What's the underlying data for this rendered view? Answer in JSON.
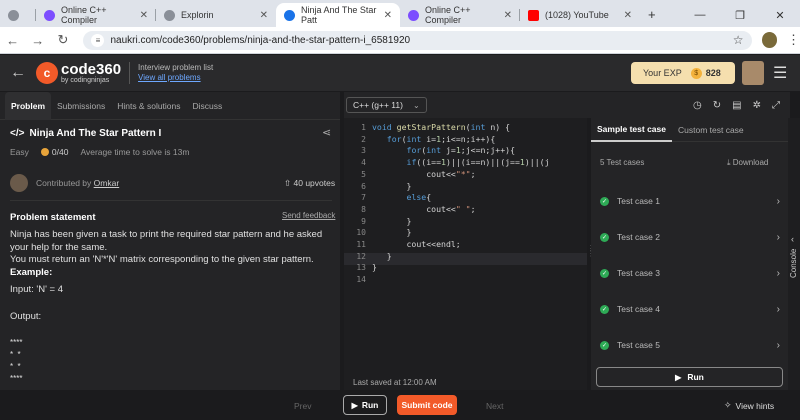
{
  "browser": {
    "tabs": [
      {
        "title": "",
        "favicon_color": "#8a8f98"
      },
      {
        "title": "Online C++ Compiler",
        "favicon_color": "#7c4dff"
      },
      {
        "title": "Explorin",
        "favicon_color": "#8a8f98"
      },
      {
        "title": "Ninja And The Star Patt",
        "favicon_color": "#1a73e8"
      },
      {
        "title": "Online C++ Compiler",
        "favicon_color": "#7c4dff"
      },
      {
        "title": "(1028) YouTube",
        "favicon_color": "#ff0000"
      }
    ],
    "url": "naukri.com/code360/problems/ninja-and-the-star-pattern-i_6581920"
  },
  "header": {
    "logo_main": "code360",
    "logo_sub": "by codingninjas",
    "interview_list": "Interview problem list",
    "view_all": "View all problems",
    "exp_label": "Your EXP",
    "exp_value": "828"
  },
  "left": {
    "tabs": [
      "Problem",
      "Submissions",
      "Hints & solutions",
      "Discuss"
    ],
    "title": "Ninja And The Star Pattern I",
    "difficulty": "Easy",
    "score": "0/40",
    "avg_time": "Average time to solve is 13m",
    "contributed_prefix": "Contributed by",
    "contributor": "Omkar",
    "upvotes": "40 upvotes",
    "ps_heading": "Problem statement",
    "send_feedback": "Send feedback",
    "para1": "Ninja has been given a task to print the required star pattern and he asked your help for the same.",
    "para2": "You must return an 'N'*'N' matrix corresponding to the given star pattern.",
    "example_label": "Example:",
    "input": "Input: 'N' = 4",
    "output_label": "Output:",
    "output_lines": [
      "****",
      "*  *",
      "*  *",
      "****"
    ]
  },
  "editor": {
    "language": "C++ (g++ 11)",
    "last_saved": "Last saved at 12:00 AM",
    "lines": [
      "1",
      "2",
      "3",
      "4",
      "5",
      "6",
      "7",
      "8",
      "9",
      "10",
      "11",
      "12",
      "13",
      "14"
    ]
  },
  "tests": {
    "tabs": [
      "Sample test case",
      "Custom test case"
    ],
    "count_label": "5 Test cases",
    "download": "Download",
    "cases": [
      "Test case 1",
      "Test case 2",
      "Test case 3",
      "Test case 4",
      "Test case 5"
    ],
    "run": "Run",
    "console": "Console"
  },
  "footer": {
    "prev": "Prev",
    "run": "Run",
    "submit": "Submit code",
    "next": "Next",
    "hints": "View hints"
  },
  "colors": {
    "accent": "#f25a29",
    "success": "#2eaa56"
  }
}
